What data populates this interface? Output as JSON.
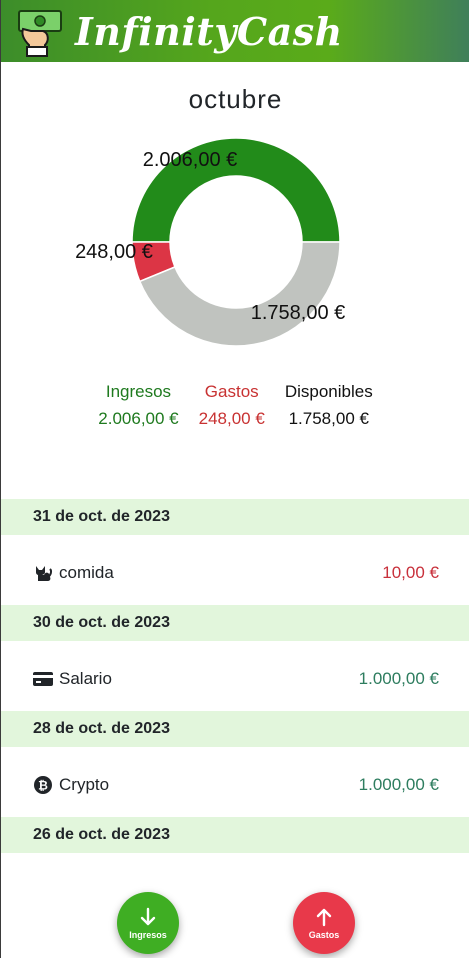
{
  "header": {
    "title": "InfinityCash",
    "logo_icon": "cash-hand-icon"
  },
  "month": "octubre",
  "chart_data": {
    "type": "pie",
    "donut": true,
    "slices": [
      {
        "label": "2.006,00 €",
        "value": 2006.0,
        "color": "#228b1a"
      },
      {
        "label": "248,00 €",
        "value": 248.0,
        "color": "#dc3545"
      },
      {
        "label": "1.758,00 €",
        "value": 1758.0,
        "color": "#c0c3bf"
      }
    ]
  },
  "summary": {
    "income": {
      "label": "Ingresos",
      "value": "2.006,00 €",
      "color": "#1f7a1f"
    },
    "expenses": {
      "label": "Gastos",
      "value": "248,00 €",
      "color": "#c83232"
    },
    "available": {
      "label": "Disponibles",
      "value": "1.758,00 €",
      "color": "#111111"
    }
  },
  "transactions": [
    {
      "date": "31 de oct. de 2023",
      "icon": "cat-icon",
      "name": "comida",
      "amount": "10,00 €",
      "type": "expense"
    },
    {
      "date": "30 de oct. de 2023",
      "icon": "credit-card-icon",
      "name": "Salario",
      "amount": "1.000,00 €",
      "type": "income"
    },
    {
      "date": "28 de oct. de 2023",
      "icon": "bitcoin-icon",
      "name": "Crypto",
      "amount": "1.000,00 €",
      "type": "income"
    },
    {
      "date": "26 de oct. de 2023"
    }
  ],
  "buttons": {
    "income_label": "Ingresos",
    "expense_label": "Gastos",
    "income_icon": "arrow-down-icon",
    "expense_icon": "arrow-up-icon"
  }
}
